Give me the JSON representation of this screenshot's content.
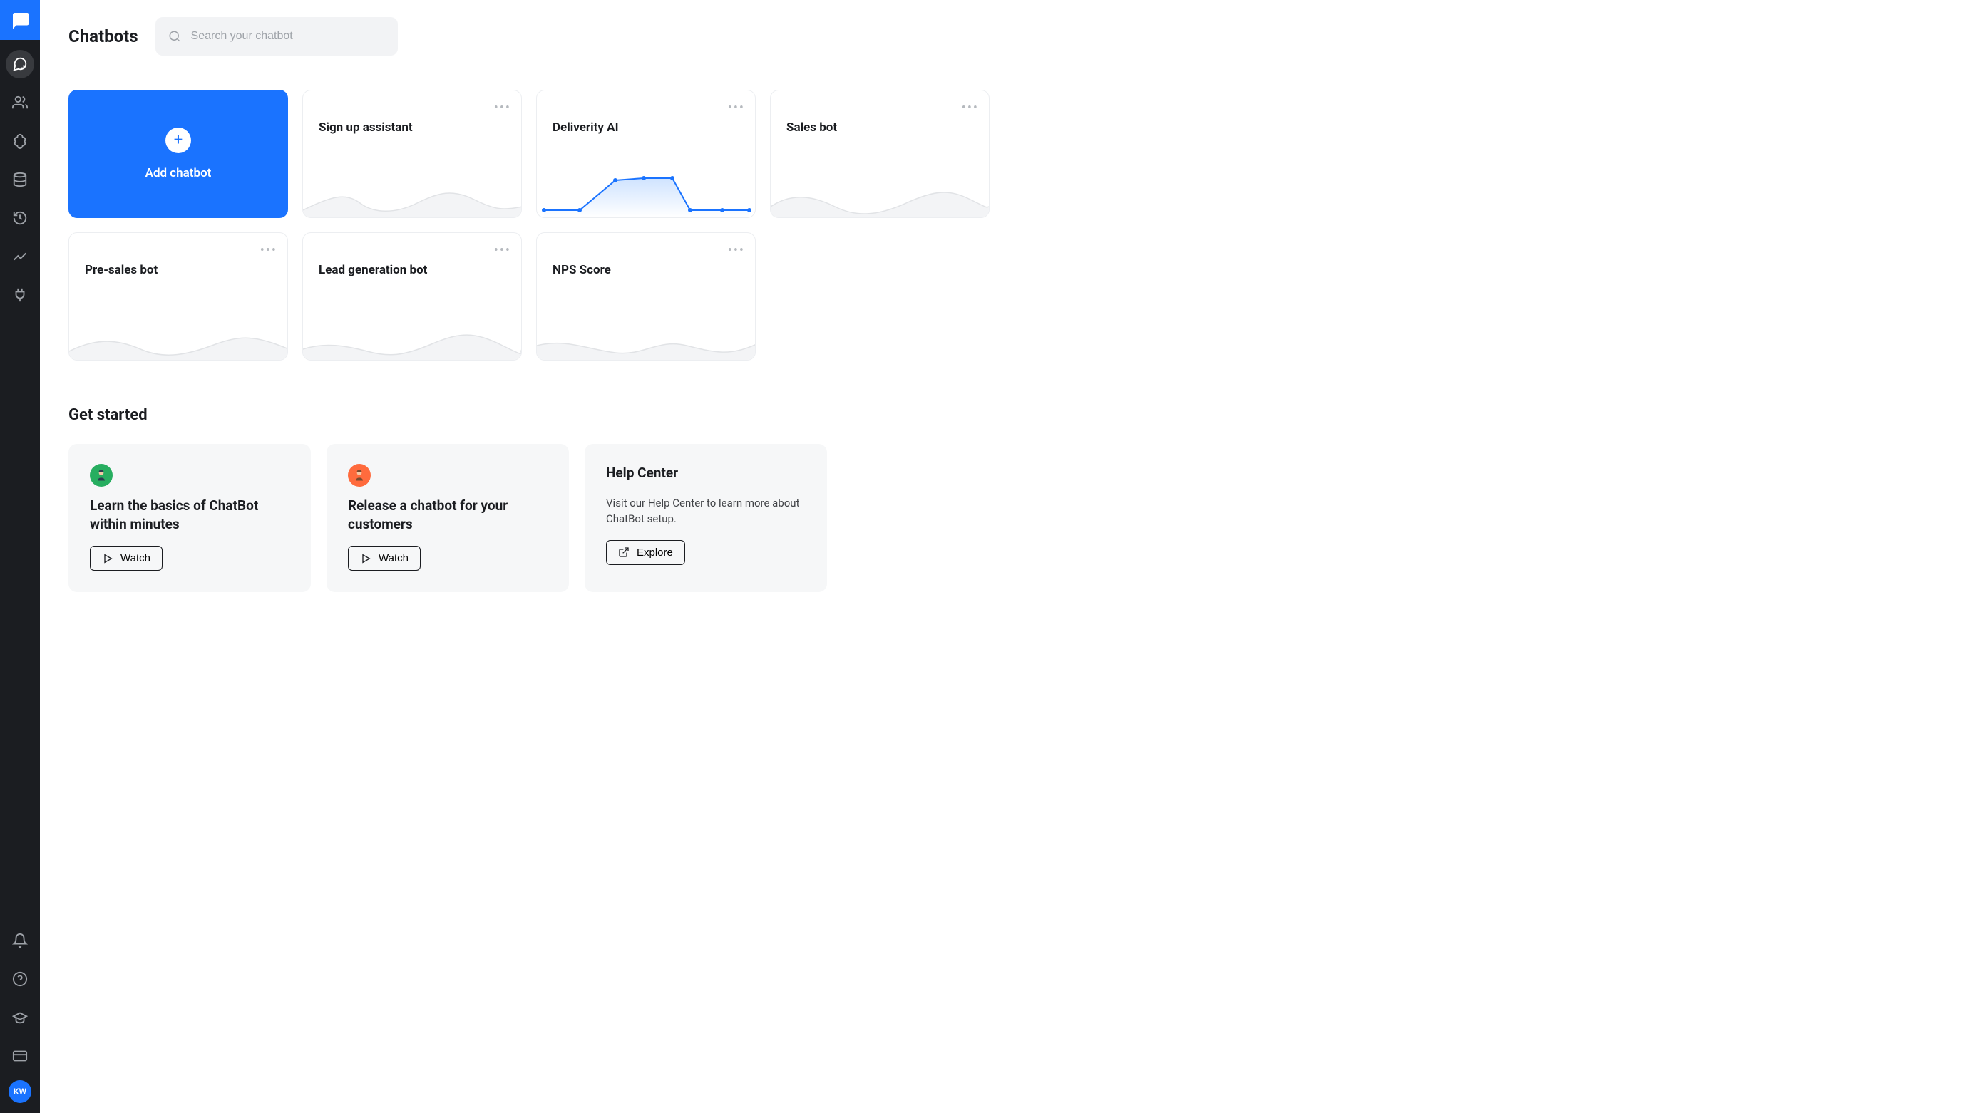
{
  "sidebar": {
    "avatar_initials": "KW"
  },
  "header": {
    "title": "Chatbots"
  },
  "search": {
    "placeholder": "Search your chatbot"
  },
  "add_card": {
    "label": "Add chatbot"
  },
  "bots": [
    {
      "name": "Sign up assistant"
    },
    {
      "name": "Deliverity AI"
    },
    {
      "name": "Sales bot"
    },
    {
      "name": "Pre-sales bot"
    },
    {
      "name": "Lead generation bot"
    },
    {
      "name": "NPS Score"
    }
  ],
  "get_started": {
    "title": "Get started",
    "cards": [
      {
        "title": "Learn the basics of ChatBot within minutes",
        "button": "Watch"
      },
      {
        "title": "Release a chatbot for your customers",
        "button": "Watch"
      },
      {
        "title": "Help Center",
        "desc": "Visit our Help Center to learn more about ChatBot setup.",
        "button": "Explore"
      }
    ]
  }
}
